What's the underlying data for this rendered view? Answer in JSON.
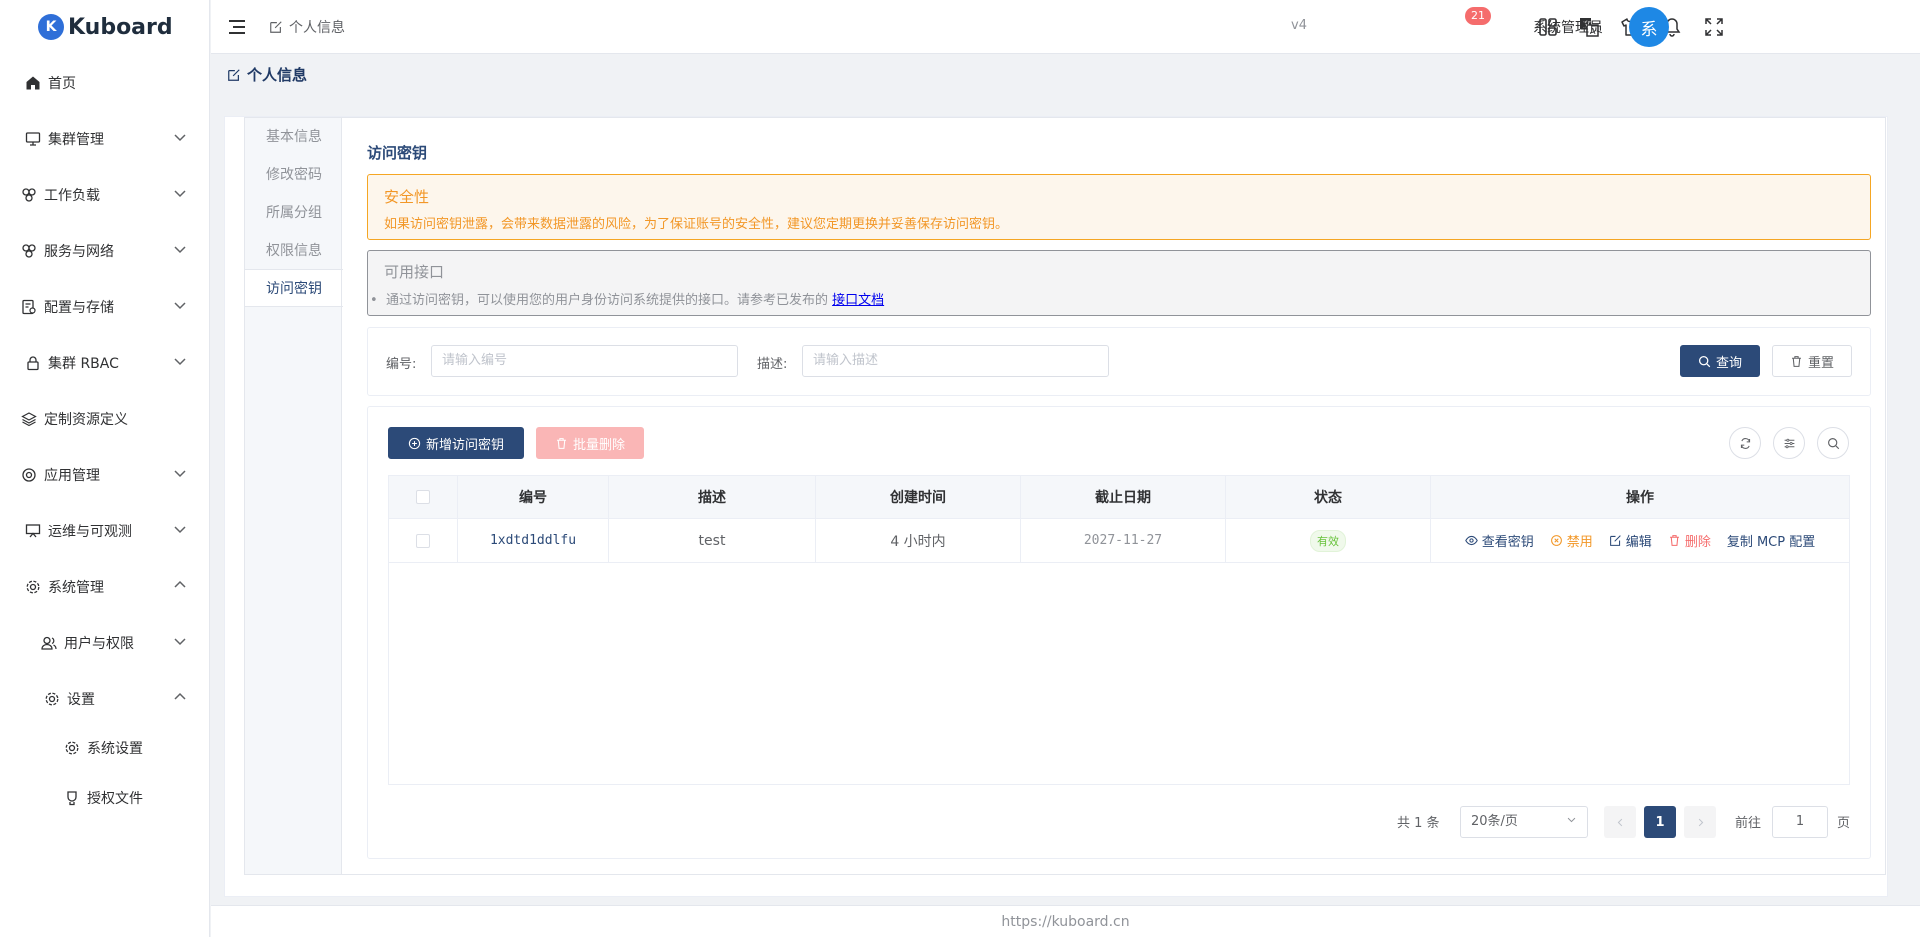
{
  "app": {
    "logo_letter": "K",
    "name": "Kuboard"
  },
  "sidebar": {
    "items": [
      {
        "label": "首页",
        "icon": "home-icon"
      },
      {
        "label": "集群管理",
        "icon": "monitor-icon"
      },
      {
        "label": "工作负载",
        "icon": "workload-icon"
      },
      {
        "label": "服务与网络",
        "icon": "network-icon"
      },
      {
        "label": "配置与存储",
        "icon": "config-storage-icon"
      },
      {
        "label": "集群 RBAC",
        "icon": "lock-icon"
      },
      {
        "label": "定制资源定义",
        "icon": "layers-icon"
      },
      {
        "label": "应用管理",
        "icon": "app-icon"
      },
      {
        "label": "运维与可观测",
        "icon": "presentation-icon"
      },
      {
        "label": "系统管理",
        "icon": "gear-icon"
      },
      {
        "label": "用户与权限",
        "icon": "users-icon"
      },
      {
        "label": "设置",
        "icon": "gear-icon"
      },
      {
        "label": "系统设置",
        "icon": "gear-icon"
      },
      {
        "label": "授权文件",
        "icon": "license-icon"
      }
    ]
  },
  "header": {
    "breadcrumb": "个人信息",
    "version": "v4",
    "notification_count": "21",
    "username": "系统管理员",
    "avatar_text": "系"
  },
  "page": {
    "title": "个人信息"
  },
  "tabs": [
    "基本信息",
    "修改密码",
    "所属分组",
    "权限信息",
    "访问密钥"
  ],
  "section": {
    "title": "访问密钥",
    "warning_title": "安全性",
    "warning_text": "如果访问密钥泄露，会带来数据泄露的风险，为了保证账号的安全性，建议您定期更换并妥善保存访问密钥。",
    "info_title": "可用接口",
    "info_text": "通过访问密钥，可以使用您的用户身份访问系统提供的接口。请参考已发布的",
    "info_link": "接口文档"
  },
  "search": {
    "id_label": "编号:",
    "id_placeholder": "请输入编号",
    "desc_label": "描述:",
    "desc_placeholder": "请输入描述",
    "query_label": "查询",
    "reset_label": "重置"
  },
  "toolbar": {
    "add_label": "新增访问密钥",
    "batch_delete_label": "批量删除"
  },
  "table": {
    "columns": [
      "编号",
      "描述",
      "创建时间",
      "截止日期",
      "状态",
      "操作"
    ],
    "rows": [
      {
        "id": "1xdtd1ddlfu",
        "description": "test",
        "created": "4 小时内",
        "expires": "2027-11-27",
        "status": "有效",
        "actions": [
          "查看密钥",
          "禁用",
          "编辑",
          "删除",
          "复制 MCP 配置"
        ]
      }
    ]
  },
  "pagination": {
    "total": "共 1 条",
    "page_size": "20条/页",
    "current": "1",
    "goto_label": "前往",
    "goto_value": "1",
    "page_suffix": "页"
  },
  "footer": {
    "text": "https://kuboard.cn"
  },
  "colors": {
    "primary": "#2c4a78",
    "warning": "#f29727",
    "danger": "#f56c6c",
    "success": "#67c23a",
    "avatar": "#1e88e5"
  }
}
